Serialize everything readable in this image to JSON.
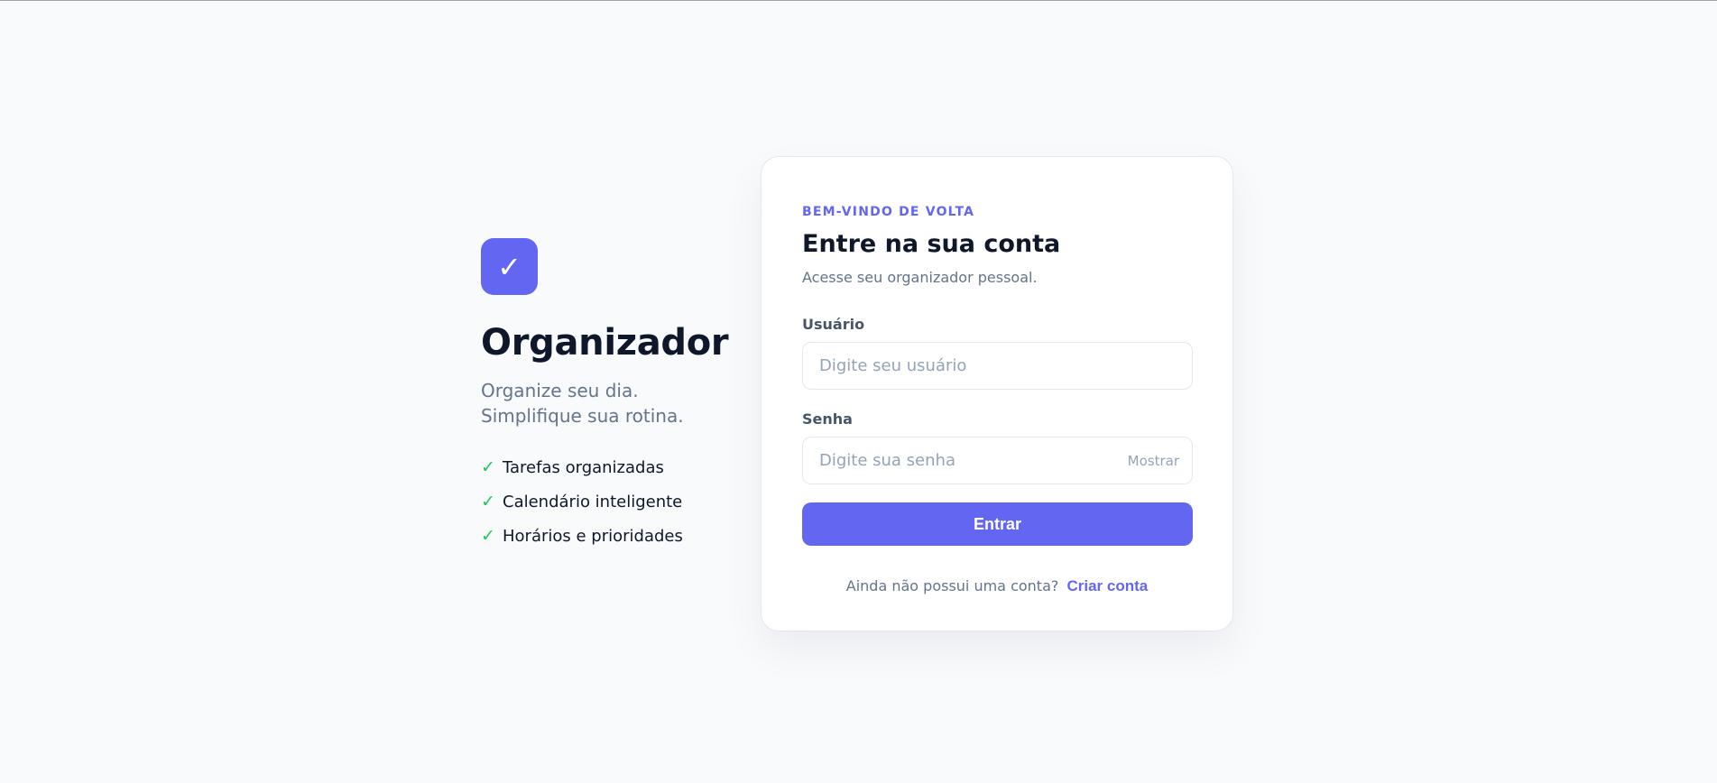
{
  "brand": {
    "logo_glyph": "✓",
    "logo_icon": "checkmark-icon",
    "title": "Organizador",
    "tagline_line1": "Organize seu dia.",
    "tagline_line2": "Simplifique sua rotina.",
    "features": [
      {
        "check": "✓",
        "label": "Tarefas organizadas"
      },
      {
        "check": "✓",
        "label": "Calendário inteligente"
      },
      {
        "check": "✓",
        "label": "Horários e prioridades"
      }
    ]
  },
  "login": {
    "eyebrow": "BEM-VINDO DE VOLTA",
    "title": "Entre na sua conta",
    "subtitle": "Acesse seu organizador pessoal.",
    "username": {
      "label": "Usuário",
      "placeholder": "Digite seu usuário",
      "value": ""
    },
    "password": {
      "label": "Senha",
      "placeholder": "Digite sua senha",
      "value": "",
      "toggle_label": "Mostrar"
    },
    "submit_label": "Entrar",
    "signup_prompt": "Ainda não possui uma conta?",
    "signup_link": "Criar conta"
  },
  "colors": {
    "accent": "#6366f1",
    "success": "#22c55e",
    "text_primary": "#0f172a",
    "text_muted": "#64748b",
    "background": "#f8fafc"
  }
}
